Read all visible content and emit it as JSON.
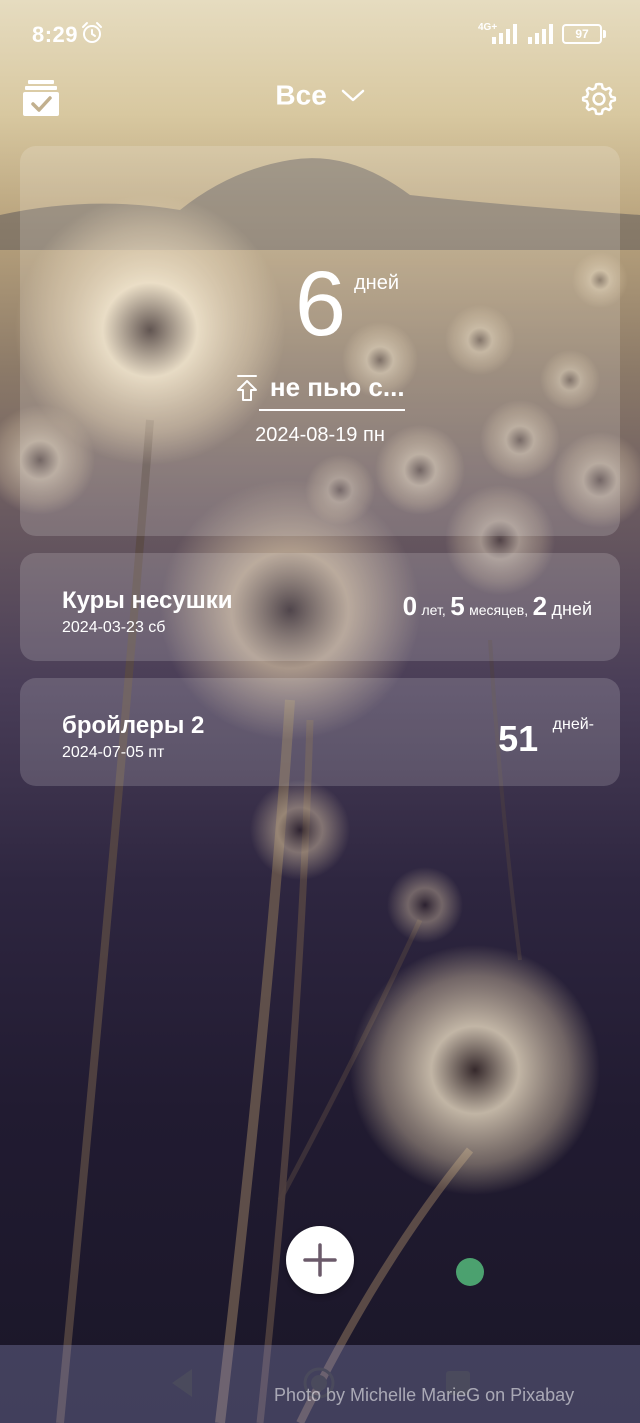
{
  "status_bar": {
    "time": "8:29",
    "network": "4G+",
    "battery": "97"
  },
  "app_bar": {
    "filter_label": "Все",
    "icons": [
      "checklist-icon",
      "chevron-down-icon",
      "gear-icon"
    ]
  },
  "main_counter": {
    "count": "6",
    "unit": "дней",
    "title": "не пью с...",
    "date": "2024-08-19 пн"
  },
  "items": [
    {
      "title": "Куры несушки",
      "date": "2024-03-23 сб",
      "years": "0",
      "years_unit": "лет,",
      "months": "5",
      "months_unit": "месяцев,",
      "days": "2",
      "days_unit": "дней"
    },
    {
      "title": "бройлеры 2",
      "date": "2024-07-05 пт",
      "count": "51",
      "unit": "дней-"
    }
  ],
  "photo_credit": "Photo by Michelle MarieG on Pixabay",
  "colors": {
    "card_bg": "rgba(255,255,255,0.16)",
    "fab_bg": "#ffffff",
    "fab_icon": "#6b5a6a",
    "nav_bar": "#8c8cbe"
  }
}
